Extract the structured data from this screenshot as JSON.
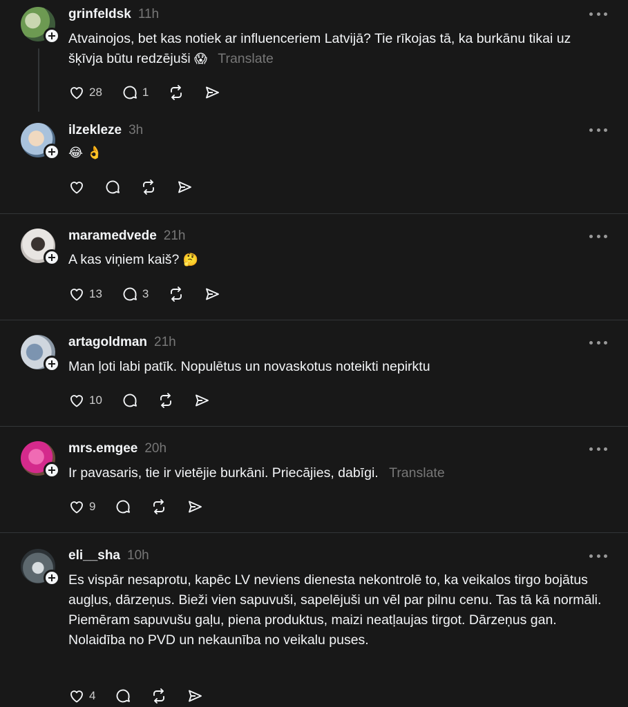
{
  "posts": [
    {
      "username": "grinfeldsk",
      "time": "11h",
      "text": "Atvainojos, bet kas notiek ar influenceriem Latvijā? Tie rīkojas tā, ka burkānu tikai uz šķīvja būtu redzējuši",
      "emoji": "😱",
      "translate": "Translate",
      "likes": "28",
      "replies": "1",
      "avatar_color": "#7fa36a"
    },
    {
      "username": "ilzekleze",
      "time": "3h",
      "text": "",
      "emoji": "😂 👌",
      "translate": "",
      "likes": "",
      "replies": "",
      "avatar_color": "#8faac4"
    },
    {
      "username": "maramedvede",
      "time": "21h",
      "text": "A kas viņiem kaiš?",
      "emoji": "🤔",
      "translate": "",
      "likes": "13",
      "replies": "3",
      "avatar_color": "#d9d4d0"
    },
    {
      "username": "artagoldman",
      "time": "21h",
      "text": "Man ļoti labi patīk. Nopulētus un novaskotus noteikti nepirktu",
      "emoji": "",
      "translate": "",
      "likes": "10",
      "replies": "",
      "avatar_color": "#b8c2cc"
    },
    {
      "username": "mrs.emgee",
      "time": "20h",
      "text": "Ir pavasaris, tie ir vietējie burkāni. Priecājies, dabīgi.",
      "emoji": "",
      "translate": "Translate",
      "likes": "9",
      "replies": "",
      "avatar_color": "#d42a8c"
    },
    {
      "username": "eli__sha",
      "time": "10h",
      "text_lines": [
        "Es vispār nesaprotu, kapēc LV neviens dienesta nekontrolē to, ka veikalos tirgo bojātus augļus, dārzeņus. Bieži vien sapuvuši, sapelējuši un vēl par pilnu cenu. Tas tā kā normāli.",
        "Piemēram sapuvušu gaļu, piena produktus, maizi neatļaujas tirgot. Dārzeņus gan. Nolaidība no PVD un nekaunība no veikalu puses."
      ],
      "emoji": "",
      "translate": "",
      "likes": "4",
      "replies": "",
      "avatar_color": "#6e7a80"
    }
  ],
  "colors": {
    "background": "#181818",
    "text": "#f3f5f7",
    "muted": "#777777",
    "divider": "#333638"
  },
  "icons": [
    "heart-icon",
    "comment-icon",
    "repost-icon",
    "share-icon",
    "more-icon",
    "follow-plus-icon"
  ]
}
